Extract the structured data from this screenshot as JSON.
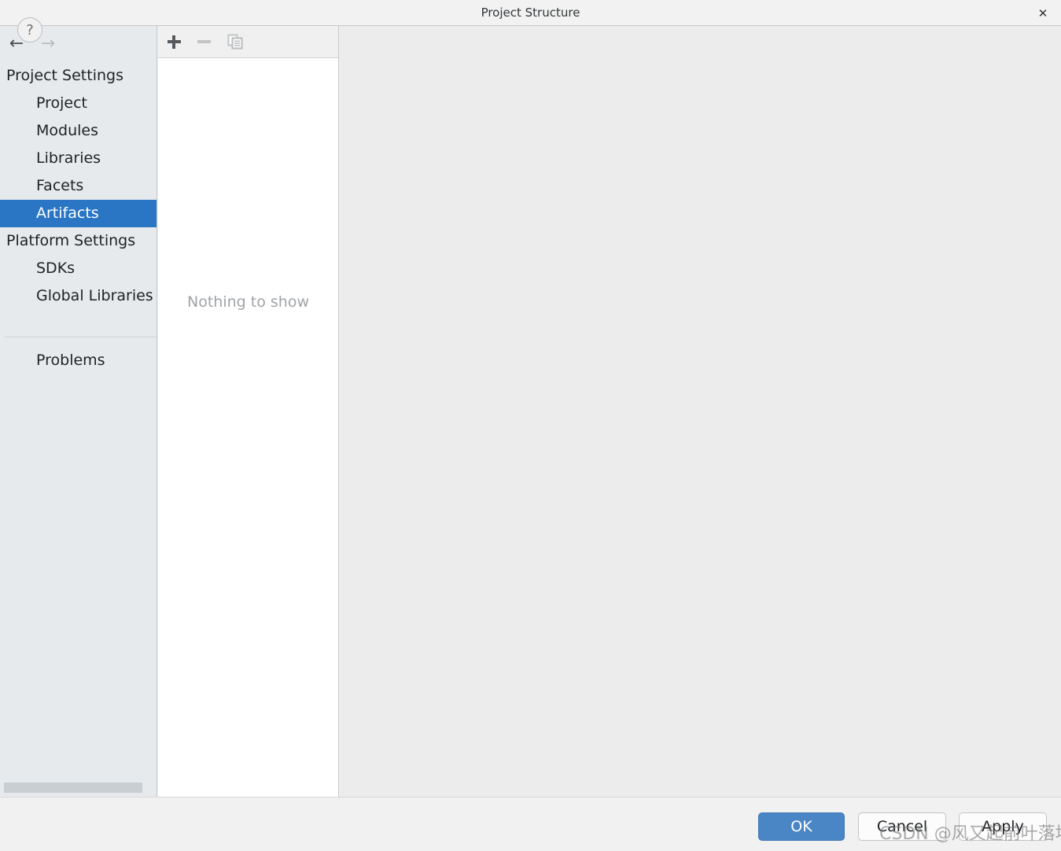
{
  "window": {
    "title": "Project Structure",
    "close_label": "✕"
  },
  "sidebar": {
    "nav": {
      "back_icon": "←",
      "forward_icon": "→"
    },
    "groups": [
      {
        "label": "Project Settings",
        "items": [
          {
            "label": "Project",
            "selected": false
          },
          {
            "label": "Modules",
            "selected": false
          },
          {
            "label": "Libraries",
            "selected": false
          },
          {
            "label": "Facets",
            "selected": false
          },
          {
            "label": "Artifacts",
            "selected": true
          }
        ]
      },
      {
        "label": "Platform Settings",
        "items": [
          {
            "label": "SDKs",
            "selected": false
          },
          {
            "label": "Global Libraries",
            "selected": false
          }
        ]
      }
    ],
    "problems_label": "Problems",
    "selected_item": "Artifacts",
    "selection_color": "#2a76c4",
    "background_color": "#e6eaed"
  },
  "middle_panel": {
    "toolbar": {
      "add_label": "+",
      "add_enabled": true,
      "remove_label": "−",
      "remove_enabled": false,
      "copy_enabled": false
    },
    "empty_message": "Nothing to show"
  },
  "bottom_bar": {
    "help_label": "?",
    "ok_label": "OK",
    "cancel_label": "Cancel",
    "apply_label": "Apply",
    "ok_color": "#4a86c5"
  },
  "watermark": {
    "text": "CSDN @风又起前叶落地"
  }
}
